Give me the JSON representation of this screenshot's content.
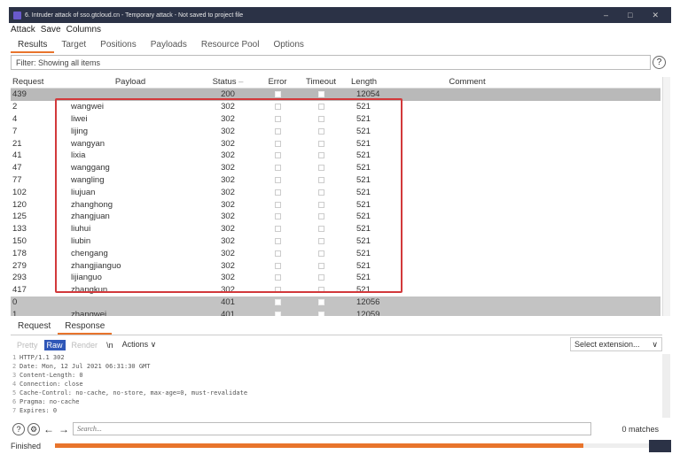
{
  "window": {
    "title": "6. Intruder attack of sso.gtcloud.cn - Temporary attack - Not saved to project file",
    "controls": [
      "–",
      "□",
      "✕"
    ]
  },
  "menu": [
    "Attack",
    "Save",
    "Columns"
  ],
  "tabs": [
    "Results",
    "Target",
    "Positions",
    "Payloads",
    "Resource Pool",
    "Options"
  ],
  "filter": {
    "text": "Filter: Showing all items",
    "help": "?"
  },
  "columns": [
    "Request",
    "Payload",
    "Status",
    "Error",
    "Timeout",
    "Length",
    "Comment"
  ],
  "rows": [
    {
      "request": "439",
      "payload": "",
      "status": "200",
      "length": "12054"
    },
    {
      "request": "2",
      "payload": "wangwei",
      "status": "302",
      "length": "521"
    },
    {
      "request": "4",
      "payload": "liwei",
      "status": "302",
      "length": "521"
    },
    {
      "request": "7",
      "payload": "lijing",
      "status": "302",
      "length": "521"
    },
    {
      "request": "21",
      "payload": "wangyan",
      "status": "302",
      "length": "521"
    },
    {
      "request": "41",
      "payload": "lixia",
      "status": "302",
      "length": "521"
    },
    {
      "request": "47",
      "payload": "wanggang",
      "status": "302",
      "length": "521"
    },
    {
      "request": "77",
      "payload": "wangling",
      "status": "302",
      "length": "521"
    },
    {
      "request": "102",
      "payload": "liujuan",
      "status": "302",
      "length": "521"
    },
    {
      "request": "120",
      "payload": "zhanghong",
      "status": "302",
      "length": "521"
    },
    {
      "request": "125",
      "payload": "zhangjuan",
      "status": "302",
      "length": "521"
    },
    {
      "request": "133",
      "payload": "liuhui",
      "status": "302",
      "length": "521"
    },
    {
      "request": "150",
      "payload": "liubin",
      "status": "302",
      "length": "521"
    },
    {
      "request": "178",
      "payload": "chengang",
      "status": "302",
      "length": "521"
    },
    {
      "request": "279",
      "payload": "zhangjianguo",
      "status": "302",
      "length": "521"
    },
    {
      "request": "293",
      "payload": "lijianguo",
      "status": "302",
      "length": "521"
    },
    {
      "request": "417",
      "payload": "zhangkun",
      "status": "302",
      "length": "521"
    },
    {
      "request": "0",
      "payload": "",
      "status": "401",
      "length": "12056"
    },
    {
      "request": "1",
      "payload": "zhangwei",
      "status": "401",
      "length": "12059"
    }
  ],
  "detail_tabs": [
    "Request",
    "Response"
  ],
  "view_buttons": [
    "Pretty",
    "Raw",
    "Render",
    "\\n",
    "Actions ∨"
  ],
  "select_extension": "Select extension...",
  "response_lines": [
    "HTTP/1.1 302",
    "Date: Mon, 12 Jul 2021 06:31:30 GMT",
    "Content-Length: 0",
    "Connection: close",
    "Cache-Control: no-cache, no-store, max-age=0, must-revalidate",
    "Pragma: no-cache",
    "Expires: 0"
  ],
  "search": {
    "placeholder": "Search...",
    "matches": "0 matches"
  },
  "status_text": "Finished",
  "progress_fraction": 0.89
}
